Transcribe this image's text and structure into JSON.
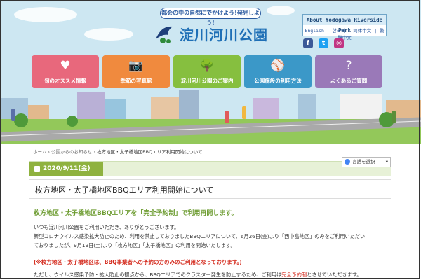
{
  "header": {
    "slogan": "都会の中の自然にでかけよう!発見しよう!",
    "logo_text": "淀川河川公園",
    "about_title": "About Yodogawa Riverside Park",
    "languages": "English | 한국어 | 简体中文 | 繁體中文"
  },
  "social": {
    "facebook": "f",
    "twitter": "t",
    "instagram": "◎"
  },
  "nav": [
    {
      "label": "旬のオススメ情報",
      "icon": "heart-icon",
      "glyph": "♥",
      "color": "#e8687c"
    },
    {
      "label": "季節の写真館",
      "icon": "camera-icon",
      "glyph": "📷",
      "color": "#f08a3e"
    },
    {
      "label": "淀川河川公園のご案内",
      "icon": "tree-icon",
      "glyph": "🌳",
      "color": "#86bf3f"
    },
    {
      "label": "公園施設の利用方法",
      "icon": "sports-icon",
      "glyph": "⚾",
      "color": "#3b98c8"
    },
    {
      "label": "よくあるご質問",
      "icon": "question-icon",
      "glyph": "?",
      "color": "#9a79b8"
    }
  ],
  "breadcrumb": {
    "home": "ホーム",
    "sep1": " › ",
    "news": "公園からのお知らせ",
    "sep2": " › ",
    "current": "枚方地区・太子橋地区BBQエリア利用開始について"
  },
  "article": {
    "date": "2020/9/11(金)",
    "lang_button": "言語を選択",
    "title": "枚方地区・太子橋地区BBQエリア利用開始について",
    "lead": "枚方地区・太子橋地区BBQエリアを「完全予約制」で利用再開します。",
    "p1": "いつも淀川河川公園をご利用いただき、ありがとうございます。",
    "p2": "新型コロナウイルス感染拡大防止のため、利用を禁止しておりましたBBQエリアについて、6月26日(金)より「西中島地区」のみをご利用いただい",
    "p3": "ておりましたが、9月19日(土)より「枚方地区」「太子橋地区」の利用を開始いたします。",
    "warn": "(※枚方地区・太子橋地区は、BBQ事業者への予約の方のみのご利用となっております。)",
    "p4_pre": "ただし、ウイルス感染予防・拡大防止の観点から、BBQエリアでのクラスター発生を防止するため、ご利用は",
    "p4_red": "完全予約制",
    "p4_post": "とさせていただきます。"
  },
  "colors": {
    "accent_green": "#8fb23f",
    "lead_green": "#6d9c31",
    "warning_red": "#d42b1e",
    "sky": "#cde7f2"
  }
}
